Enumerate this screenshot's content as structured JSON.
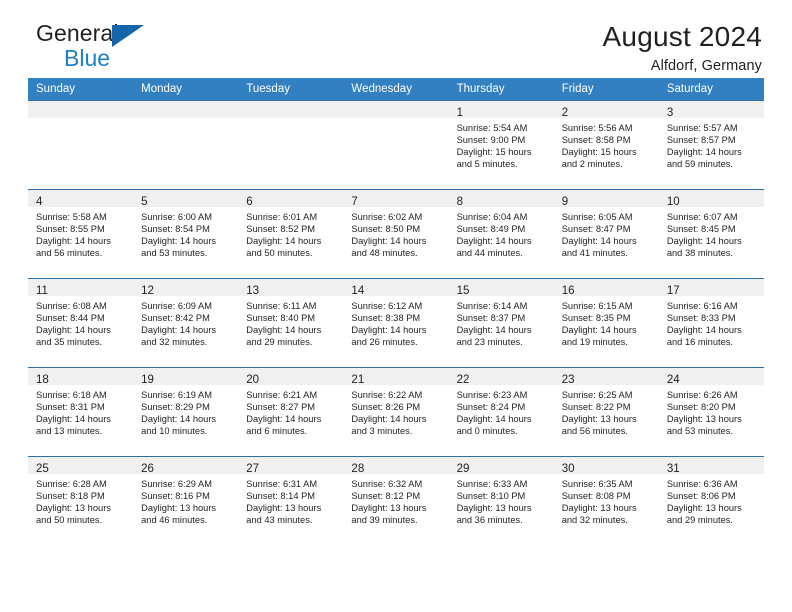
{
  "brand": {
    "name_top": "General",
    "name_bottom": "Blue",
    "accent_color": "#1f7fc4",
    "triangle_color": "#1566a8"
  },
  "header": {
    "title": "August 2024",
    "subtitle": "Alfdorf, Germany"
  },
  "theme": {
    "header_row_bg": "#3280c2",
    "daynum_band_bg": "#f0f0f0",
    "row_divider": "#2f6fa8",
    "text": "#231f20"
  },
  "weekday_headers": [
    "Sunday",
    "Monday",
    "Tuesday",
    "Wednesday",
    "Thursday",
    "Friday",
    "Saturday"
  ],
  "weeks": [
    [
      {
        "day": "",
        "sunrise": "",
        "sunset": "",
        "daylight": ""
      },
      {
        "day": "",
        "sunrise": "",
        "sunset": "",
        "daylight": ""
      },
      {
        "day": "",
        "sunrise": "",
        "sunset": "",
        "daylight": ""
      },
      {
        "day": "",
        "sunrise": "",
        "sunset": "",
        "daylight": ""
      },
      {
        "day": "1",
        "sunrise": "Sunrise: 5:54 AM",
        "sunset": "Sunset: 9:00 PM",
        "daylight": "Daylight: 15 hours and 5 minutes."
      },
      {
        "day": "2",
        "sunrise": "Sunrise: 5:56 AM",
        "sunset": "Sunset: 8:58 PM",
        "daylight": "Daylight: 15 hours and 2 minutes."
      },
      {
        "day": "3",
        "sunrise": "Sunrise: 5:57 AM",
        "sunset": "Sunset: 8:57 PM",
        "daylight": "Daylight: 14 hours and 59 minutes."
      }
    ],
    [
      {
        "day": "4",
        "sunrise": "Sunrise: 5:58 AM",
        "sunset": "Sunset: 8:55 PM",
        "daylight": "Daylight: 14 hours and 56 minutes."
      },
      {
        "day": "5",
        "sunrise": "Sunrise: 6:00 AM",
        "sunset": "Sunset: 8:54 PM",
        "daylight": "Daylight: 14 hours and 53 minutes."
      },
      {
        "day": "6",
        "sunrise": "Sunrise: 6:01 AM",
        "sunset": "Sunset: 8:52 PM",
        "daylight": "Daylight: 14 hours and 50 minutes."
      },
      {
        "day": "7",
        "sunrise": "Sunrise: 6:02 AM",
        "sunset": "Sunset: 8:50 PM",
        "daylight": "Daylight: 14 hours and 48 minutes."
      },
      {
        "day": "8",
        "sunrise": "Sunrise: 6:04 AM",
        "sunset": "Sunset: 8:49 PM",
        "daylight": "Daylight: 14 hours and 44 minutes."
      },
      {
        "day": "9",
        "sunrise": "Sunrise: 6:05 AM",
        "sunset": "Sunset: 8:47 PM",
        "daylight": "Daylight: 14 hours and 41 minutes."
      },
      {
        "day": "10",
        "sunrise": "Sunrise: 6:07 AM",
        "sunset": "Sunset: 8:45 PM",
        "daylight": "Daylight: 14 hours and 38 minutes."
      }
    ],
    [
      {
        "day": "11",
        "sunrise": "Sunrise: 6:08 AM",
        "sunset": "Sunset: 8:44 PM",
        "daylight": "Daylight: 14 hours and 35 minutes."
      },
      {
        "day": "12",
        "sunrise": "Sunrise: 6:09 AM",
        "sunset": "Sunset: 8:42 PM",
        "daylight": "Daylight: 14 hours and 32 minutes."
      },
      {
        "day": "13",
        "sunrise": "Sunrise: 6:11 AM",
        "sunset": "Sunset: 8:40 PM",
        "daylight": "Daylight: 14 hours and 29 minutes."
      },
      {
        "day": "14",
        "sunrise": "Sunrise: 6:12 AM",
        "sunset": "Sunset: 8:38 PM",
        "daylight": "Daylight: 14 hours and 26 minutes."
      },
      {
        "day": "15",
        "sunrise": "Sunrise: 6:14 AM",
        "sunset": "Sunset: 8:37 PM",
        "daylight": "Daylight: 14 hours and 23 minutes."
      },
      {
        "day": "16",
        "sunrise": "Sunrise: 6:15 AM",
        "sunset": "Sunset: 8:35 PM",
        "daylight": "Daylight: 14 hours and 19 minutes."
      },
      {
        "day": "17",
        "sunrise": "Sunrise: 6:16 AM",
        "sunset": "Sunset: 8:33 PM",
        "daylight": "Daylight: 14 hours and 16 minutes."
      }
    ],
    [
      {
        "day": "18",
        "sunrise": "Sunrise: 6:18 AM",
        "sunset": "Sunset: 8:31 PM",
        "daylight": "Daylight: 14 hours and 13 minutes."
      },
      {
        "day": "19",
        "sunrise": "Sunrise: 6:19 AM",
        "sunset": "Sunset: 8:29 PM",
        "daylight": "Daylight: 14 hours and 10 minutes."
      },
      {
        "day": "20",
        "sunrise": "Sunrise: 6:21 AM",
        "sunset": "Sunset: 8:27 PM",
        "daylight": "Daylight: 14 hours and 6 minutes."
      },
      {
        "day": "21",
        "sunrise": "Sunrise: 6:22 AM",
        "sunset": "Sunset: 8:26 PM",
        "daylight": "Daylight: 14 hours and 3 minutes."
      },
      {
        "day": "22",
        "sunrise": "Sunrise: 6:23 AM",
        "sunset": "Sunset: 8:24 PM",
        "daylight": "Daylight: 14 hours and 0 minutes."
      },
      {
        "day": "23",
        "sunrise": "Sunrise: 6:25 AM",
        "sunset": "Sunset: 8:22 PM",
        "daylight": "Daylight: 13 hours and 56 minutes."
      },
      {
        "day": "24",
        "sunrise": "Sunrise: 6:26 AM",
        "sunset": "Sunset: 8:20 PM",
        "daylight": "Daylight: 13 hours and 53 minutes."
      }
    ],
    [
      {
        "day": "25",
        "sunrise": "Sunrise: 6:28 AM",
        "sunset": "Sunset: 8:18 PM",
        "daylight": "Daylight: 13 hours and 50 minutes."
      },
      {
        "day": "26",
        "sunrise": "Sunrise: 6:29 AM",
        "sunset": "Sunset: 8:16 PM",
        "daylight": "Daylight: 13 hours and 46 minutes."
      },
      {
        "day": "27",
        "sunrise": "Sunrise: 6:31 AM",
        "sunset": "Sunset: 8:14 PM",
        "daylight": "Daylight: 13 hours and 43 minutes."
      },
      {
        "day": "28",
        "sunrise": "Sunrise: 6:32 AM",
        "sunset": "Sunset: 8:12 PM",
        "daylight": "Daylight: 13 hours and 39 minutes."
      },
      {
        "day": "29",
        "sunrise": "Sunrise: 6:33 AM",
        "sunset": "Sunset: 8:10 PM",
        "daylight": "Daylight: 13 hours and 36 minutes."
      },
      {
        "day": "30",
        "sunrise": "Sunrise: 6:35 AM",
        "sunset": "Sunset: 8:08 PM",
        "daylight": "Daylight: 13 hours and 32 minutes."
      },
      {
        "day": "31",
        "sunrise": "Sunrise: 6:36 AM",
        "sunset": "Sunset: 8:06 PM",
        "daylight": "Daylight: 13 hours and 29 minutes."
      }
    ]
  ]
}
